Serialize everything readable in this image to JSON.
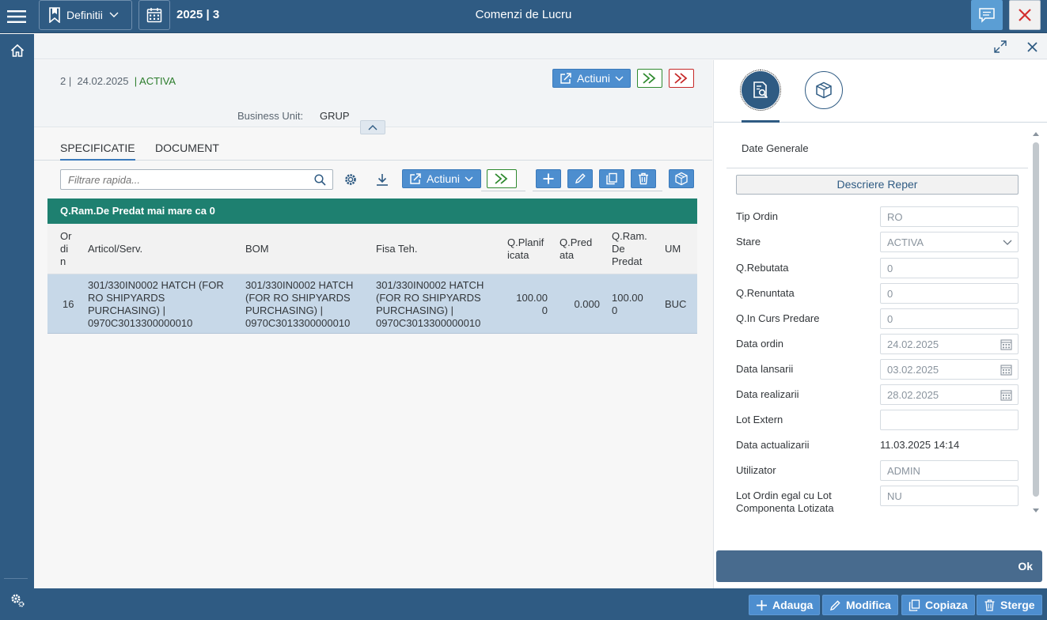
{
  "topbar": {
    "definitions_label": "Definitii",
    "period": "2025 | 3",
    "title": "Comenzi de Lucru"
  },
  "header": {
    "record_prefix": "2 |",
    "date": "24.02.2025",
    "status": "| ACTIVA",
    "actions_label": "Actiuni",
    "business_unit_label": "Business Unit:",
    "business_unit_value": "GRUP"
  },
  "tabs": [
    {
      "label": "SPECIFICATIE",
      "active": true
    },
    {
      "label": "DOCUMENT",
      "active": false
    }
  ],
  "toolbar": {
    "filter_placeholder": "Filtrare rapida...",
    "actions_label": "Actiuni"
  },
  "grid": {
    "group_label": "Q.Ram.De Predat mai mare ca 0",
    "columns": {
      "ordin": [
        "Or",
        "di",
        "n"
      ],
      "articol": "Articol/Serv.",
      "bom": "BOM",
      "fisa": "Fisa Teh.",
      "q_planif": [
        "Q.Planif",
        "icata"
      ],
      "q_predata": [
        "Q.Pred",
        "ata"
      ],
      "q_ram": [
        "Q.Ram.",
        "De",
        "Predat"
      ],
      "um": "UM"
    },
    "rows": [
      {
        "ordin": "16",
        "articol": [
          "301/330IN0002 HATCH (FOR",
          "RO SHIPYARDS",
          "PURCHASING) |",
          "0970C3013300000010"
        ],
        "bom": [
          "301/330IN0002 HATCH",
          "(FOR RO SHIPYARDS",
          "PURCHASING) |",
          "0970C3013300000010"
        ],
        "fisa": [
          "301/330IN0002 HATCH",
          "(FOR RO SHIPYARDS",
          "PURCHASING) |",
          "0970C3013300000010"
        ],
        "q_planif": [
          "100.00",
          "0"
        ],
        "q_predata": "0.000",
        "q_ram": [
          "100.00",
          "0"
        ],
        "um": "BUC"
      }
    ]
  },
  "details": {
    "section_title": "Date Generale",
    "describe_button": "Descriere Reper",
    "fields": {
      "tip_ordin": {
        "label": "Tip Ordin",
        "value": "RO"
      },
      "stare": {
        "label": "Stare",
        "value": "ACTIVA"
      },
      "q_rebutata": {
        "label": "Q.Rebutata",
        "value": "0"
      },
      "q_renuntata": {
        "label": "Q.Renuntata",
        "value": "0"
      },
      "q_in_curs": {
        "label": "Q.In Curs Predare",
        "value": "0"
      },
      "data_ordin": {
        "label": "Data ordin",
        "value": "24.02.2025"
      },
      "data_lansarii": {
        "label": "Data lansarii",
        "value": "03.02.2025"
      },
      "data_realizarii": {
        "label": "Data realizarii",
        "value": "28.02.2025"
      },
      "lot_extern": {
        "label": "Lot Extern",
        "value": ""
      },
      "data_actualizarii": {
        "label": "Data actualizarii",
        "value": "11.03.2025 14:14"
      },
      "utilizator": {
        "label": "Utilizator",
        "value": "ADMIN"
      },
      "lot_ordin": {
        "label": [
          "Lot Ordin egal cu Lot",
          "Componenta Lotizata"
        ],
        "value": "NU"
      }
    },
    "ok_label": "Ok"
  },
  "bottombar": {
    "add": "Adauga",
    "modify": "Modifica",
    "copy": "Copiaza",
    "delete": "Sterge"
  },
  "colors": {
    "primary": "#2f5b83",
    "accent_blue": "#4d8ecf",
    "group_bar": "#1e8070",
    "selected_row": "#c7d8e8",
    "status_green": "#2b7c2b",
    "danger_red": "#c62828"
  },
  "icons": {
    "menu": "hamburger-icon",
    "bookmark": "bookmark-icon",
    "calendar": "calendar-icon",
    "message": "message-icon",
    "close": "close-icon",
    "home": "home-icon",
    "settings": "settings-gear-icon"
  }
}
